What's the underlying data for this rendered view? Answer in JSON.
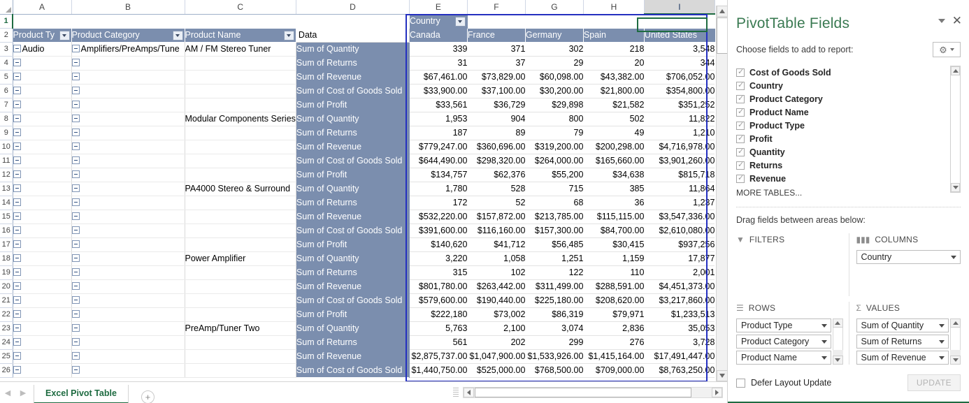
{
  "sheet": {
    "column_letters": [
      "A",
      "B",
      "C",
      "D",
      "E",
      "F",
      "G",
      "H",
      "I"
    ],
    "selected_column": "I",
    "selected_cell": "I1",
    "row_numbers": [
      1,
      2,
      3,
      4,
      5,
      6,
      7,
      8,
      9,
      10,
      11,
      12,
      13,
      14,
      15,
      16,
      17,
      18,
      19,
      20,
      21,
      22,
      23,
      24,
      25,
      26
    ],
    "headers": {
      "product_type": "Product Ty",
      "product_category": "Product Category",
      "product_name": "Product Name",
      "data": "Data",
      "country": "Country"
    },
    "country_columns": [
      "Canada",
      "France",
      "Germany",
      "Spain",
      "United States"
    ],
    "tab_label": "Excel Pivot Table",
    "add_sheet_icon": "plus-circle-icon"
  },
  "pivot": {
    "product_type": "Audio",
    "product_category": "Amplifiers/PreAmps/Tune",
    "groups": [
      {
        "product_name": "AM / FM Stereo Tuner",
        "rows": [
          {
            "measure": "Sum of Quantity",
            "values": [
              "339",
              "371",
              "302",
              "218",
              "3,548"
            ]
          },
          {
            "measure": "Sum of Returns",
            "values": [
              "31",
              "37",
              "29",
              "20",
              "344"
            ]
          },
          {
            "measure": "Sum of Revenue",
            "values": [
              "$67,461.00",
              "$73,829.00",
              "$60,098.00",
              "$43,382.00",
              "$706,052.00"
            ]
          },
          {
            "measure": "Sum of Cost of Goods Sold",
            "values": [
              "$33,900.00",
              "$37,100.00",
              "$30,200.00",
              "$21,800.00",
              "$354,800.00"
            ]
          },
          {
            "measure": "Sum of Profit",
            "values": [
              "$33,561",
              "$36,729",
              "$29,898",
              "$21,582",
              "$351,252"
            ]
          }
        ]
      },
      {
        "product_name": "Modular Components Series",
        "rows": [
          {
            "measure": "Sum of Quantity",
            "values": [
              "1,953",
              "904",
              "800",
              "502",
              "11,822"
            ]
          },
          {
            "measure": "Sum of Returns",
            "values": [
              "187",
              "89",
              "79",
              "49",
              "1,210"
            ]
          },
          {
            "measure": "Sum of Revenue",
            "values": [
              "$779,247.00",
              "$360,696.00",
              "$319,200.00",
              "$200,298.00",
              "$4,716,978.00"
            ]
          },
          {
            "measure": "Sum of Cost of Goods Sold",
            "values": [
              "$644,490.00",
              "$298,320.00",
              "$264,000.00",
              "$165,660.00",
              "$3,901,260.00"
            ]
          },
          {
            "measure": "Sum of Profit",
            "values": [
              "$134,757",
              "$62,376",
              "$55,200",
              "$34,638",
              "$815,718"
            ]
          }
        ]
      },
      {
        "product_name": "PA4000 Stereo & Surround",
        "rows": [
          {
            "measure": "Sum of Quantity",
            "values": [
              "1,780",
              "528",
              "715",
              "385",
              "11,864"
            ]
          },
          {
            "measure": "Sum of Returns",
            "values": [
              "172",
              "52",
              "68",
              "36",
              "1,237"
            ]
          },
          {
            "measure": "Sum of Revenue",
            "values": [
              "$532,220.00",
              "$157,872.00",
              "$213,785.00",
              "$115,115.00",
              "$3,547,336.00"
            ]
          },
          {
            "measure": "Sum of Cost of Goods Sold",
            "values": [
              "$391,600.00",
              "$116,160.00",
              "$157,300.00",
              "$84,700.00",
              "$2,610,080.00"
            ]
          },
          {
            "measure": "Sum of Profit",
            "values": [
              "$140,620",
              "$41,712",
              "$56,485",
              "$30,415",
              "$937,256"
            ]
          }
        ]
      },
      {
        "product_name": "Power Amplifier",
        "rows": [
          {
            "measure": "Sum of Quantity",
            "values": [
              "3,220",
              "1,058",
              "1,251",
              "1,159",
              "17,877"
            ]
          },
          {
            "measure": "Sum of Returns",
            "values": [
              "315",
              "102",
              "122",
              "110",
              "2,001"
            ]
          },
          {
            "measure": "Sum of Revenue",
            "values": [
              "$801,780.00",
              "$263,442.00",
              "$311,499.00",
              "$288,591.00",
              "$4,451,373.00"
            ]
          },
          {
            "measure": "Sum of Cost of Goods Sold",
            "values": [
              "$579,600.00",
              "$190,440.00",
              "$225,180.00",
              "$208,620.00",
              "$3,217,860.00"
            ]
          },
          {
            "measure": "Sum of Profit",
            "values": [
              "$222,180",
              "$73,002",
              "$86,319",
              "$79,971",
              "$1,233,513"
            ]
          }
        ]
      },
      {
        "product_name": "PreAmp/Tuner Two",
        "rows": [
          {
            "measure": "Sum of Quantity",
            "values": [
              "5,763",
              "2,100",
              "3,074",
              "2,836",
              "35,053"
            ]
          },
          {
            "measure": "Sum of Returns",
            "values": [
              "561",
              "202",
              "299",
              "276",
              "3,728"
            ]
          },
          {
            "measure": "Sum of Revenue",
            "values": [
              "$2,875,737.00",
              "$1,047,900.00",
              "$1,533,926.00",
              "$1,415,164.00",
              "$17,491,447.00"
            ]
          },
          {
            "measure": "Sum of Cost of Goods Sold",
            "values": [
              "$1,440,750.00",
              "$525,000.00",
              "$768,500.00",
              "$709,000.00",
              "$8,763,250.00"
            ]
          }
        ]
      }
    ]
  },
  "pane": {
    "title": "PivotTable Fields",
    "collapse_icon": "chevron-down-icon",
    "close_icon": "close-icon",
    "choose_label": "Choose fields to add to report:",
    "gear_icon": "gear-icon",
    "fields": [
      {
        "label": "Cost of Goods Sold",
        "checked": true
      },
      {
        "label": "Country",
        "checked": true
      },
      {
        "label": "Product Category",
        "checked": true
      },
      {
        "label": "Product Name",
        "checked": true
      },
      {
        "label": "Product Type",
        "checked": true
      },
      {
        "label": "Profit",
        "checked": true
      },
      {
        "label": "Quantity",
        "checked": true
      },
      {
        "label": "Returns",
        "checked": true
      },
      {
        "label": "Revenue",
        "checked": true
      }
    ],
    "more_tables": "MORE TABLES...",
    "drag_label": "Drag fields between areas below:",
    "areas": {
      "filters": {
        "label": "FILTERS",
        "icon": "filter-icon",
        "chips": []
      },
      "columns": {
        "label": "COLUMNS",
        "icon": "columns-icon",
        "chips": [
          "Country"
        ]
      },
      "rows": {
        "label": "ROWS",
        "icon": "rows-icon",
        "chips": [
          "Product Type",
          "Product Category",
          "Product Name"
        ]
      },
      "values": {
        "label": "VALUES",
        "icon": "sigma-icon",
        "chips": [
          "Sum of Quantity",
          "Sum of Returns",
          "Sum of Revenue"
        ]
      }
    },
    "defer_label": "Defer Layout Update",
    "update_label": "UPDATE"
  },
  "colors": {
    "pivot_header_band": "#7b8eae",
    "selection_blue": "#2430c0",
    "excel_green": "#1e6b41",
    "pane_title_green": "#3a7a52"
  }
}
